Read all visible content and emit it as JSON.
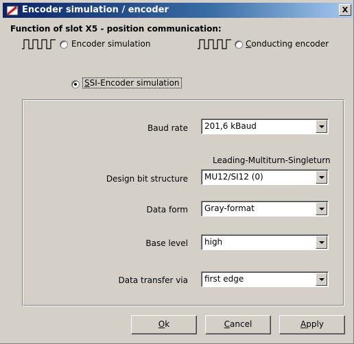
{
  "window": {
    "title": "Encoder simulation / encoder",
    "close_label": "X",
    "icon": "app-icon"
  },
  "function": {
    "heading": "Function of slot X5 - position communication:",
    "options": [
      {
        "label": "Encoder simulation",
        "selected": false,
        "icon": "pulse-train-icon"
      },
      {
        "label": "Conducting encoder",
        "selected": false,
        "icon": "pulse-train-icon"
      },
      {
        "label": "SSI-Encoder simulation",
        "selected": true
      }
    ]
  },
  "settings": {
    "baud_rate": {
      "label": "Baud rate",
      "value": "201,6 kBaud"
    },
    "bit_structure": {
      "label": "Design bit structure",
      "caption": "Leading-Multiturn-Singleturn",
      "value": "MU12/SI12 (0)"
    },
    "data_form": {
      "label": "Data form",
      "value": "Gray-format"
    },
    "base_level": {
      "label": "Base level",
      "value": "high"
    },
    "data_transfer": {
      "label": "Data transfer via",
      "value": "first edge"
    }
  },
  "buttons": {
    "ok": {
      "label": "Ok",
      "mnemonic": "O",
      "rest": "k"
    },
    "cancel": {
      "label": "Cancel",
      "mnemonic": "C",
      "rest": "ancel"
    },
    "apply": {
      "label": "Apply",
      "mnemonic": "A",
      "rest": "pply"
    }
  }
}
